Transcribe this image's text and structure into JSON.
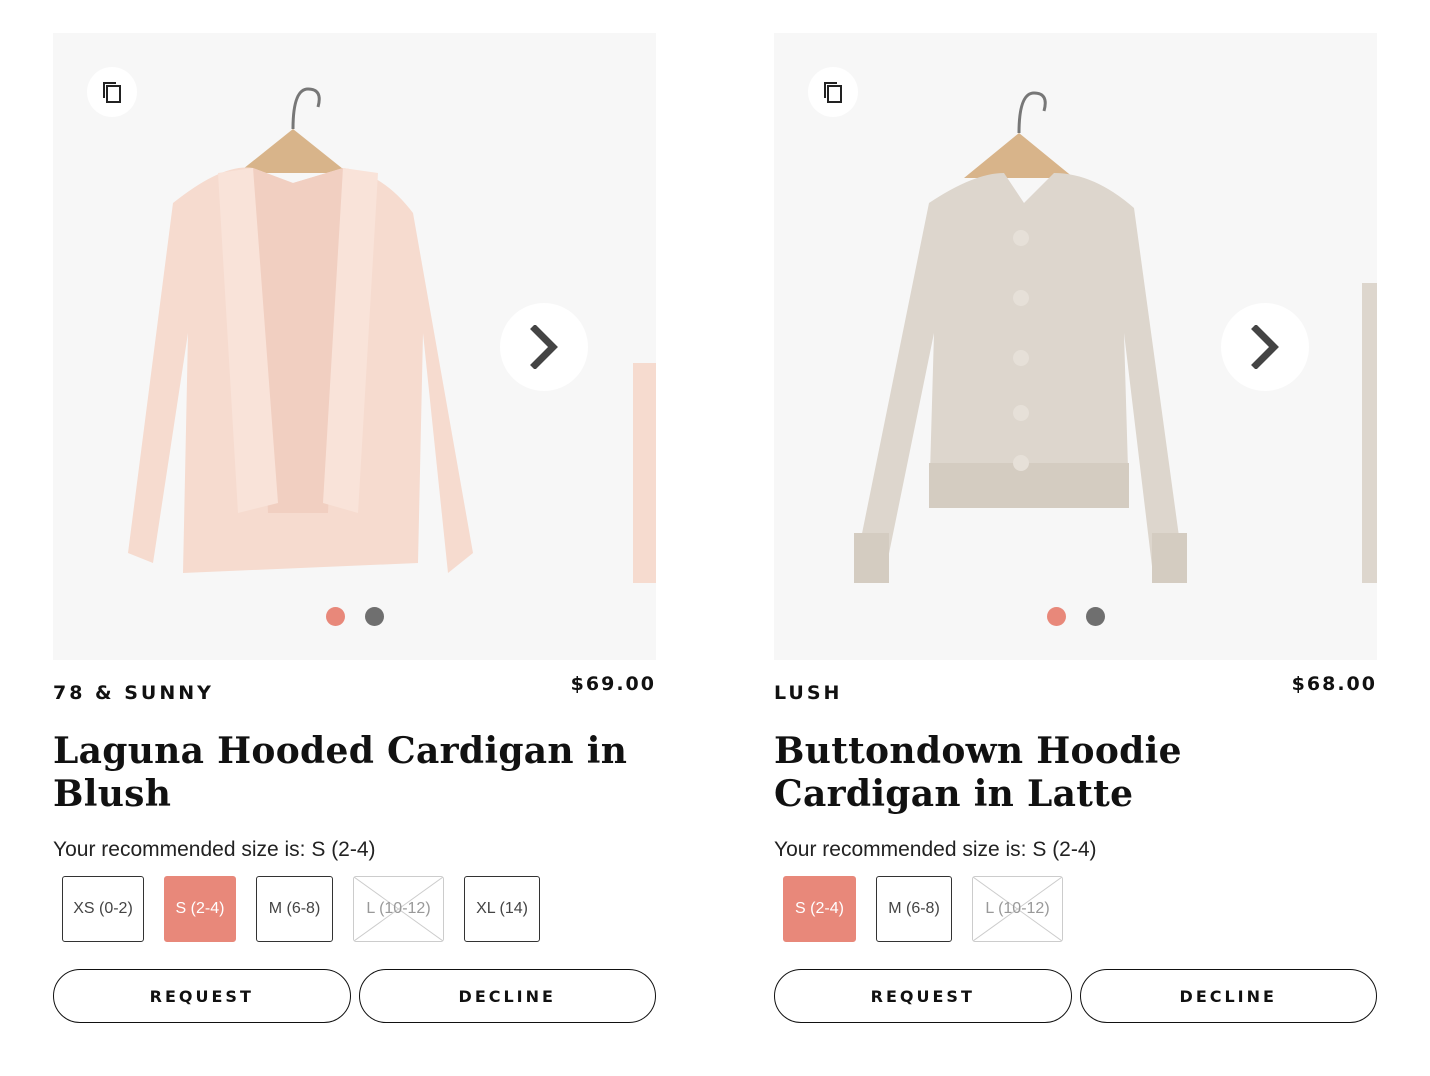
{
  "cards": [
    {
      "brand": "78 & SUNNY",
      "price": "$69.00",
      "title": "Laguna Hooded Cardigan in Blush",
      "recommended": "Your recommended size is: S (2-4)",
      "sizes": [
        {
          "label": "XS (0-2)",
          "state": "available"
        },
        {
          "label": "S (2-4)",
          "state": "selected"
        },
        {
          "label": "M (6-8)",
          "state": "available"
        },
        {
          "label": "L (10-12)",
          "state": "unavailable"
        },
        {
          "label": "XL (14)",
          "state": "available"
        }
      ],
      "request_label": "REQUEST",
      "decline_label": "DECLINE",
      "garment_color": "#f8ddd2"
    },
    {
      "brand": "LUSH",
      "price": "$68.00",
      "title": "Buttondown Hoodie Cardigan in Latte",
      "recommended": "Your recommended size is: S (2-4)",
      "sizes": [
        {
          "label": "S (2-4)",
          "state": "selected"
        },
        {
          "label": "M (6-8)",
          "state": "available"
        },
        {
          "label": "L (10-12)",
          "state": "unavailable"
        }
      ],
      "request_label": "REQUEST",
      "decline_label": "DECLINE",
      "garment_color": "#ddd6cd"
    }
  ],
  "icons": {
    "copy": "copy-icon",
    "next": "chevron-right-icon"
  },
  "colors": {
    "accent": "#e8887a",
    "dot_inactive": "#6f6f6f",
    "photo_bg": "#f7f7f7"
  }
}
